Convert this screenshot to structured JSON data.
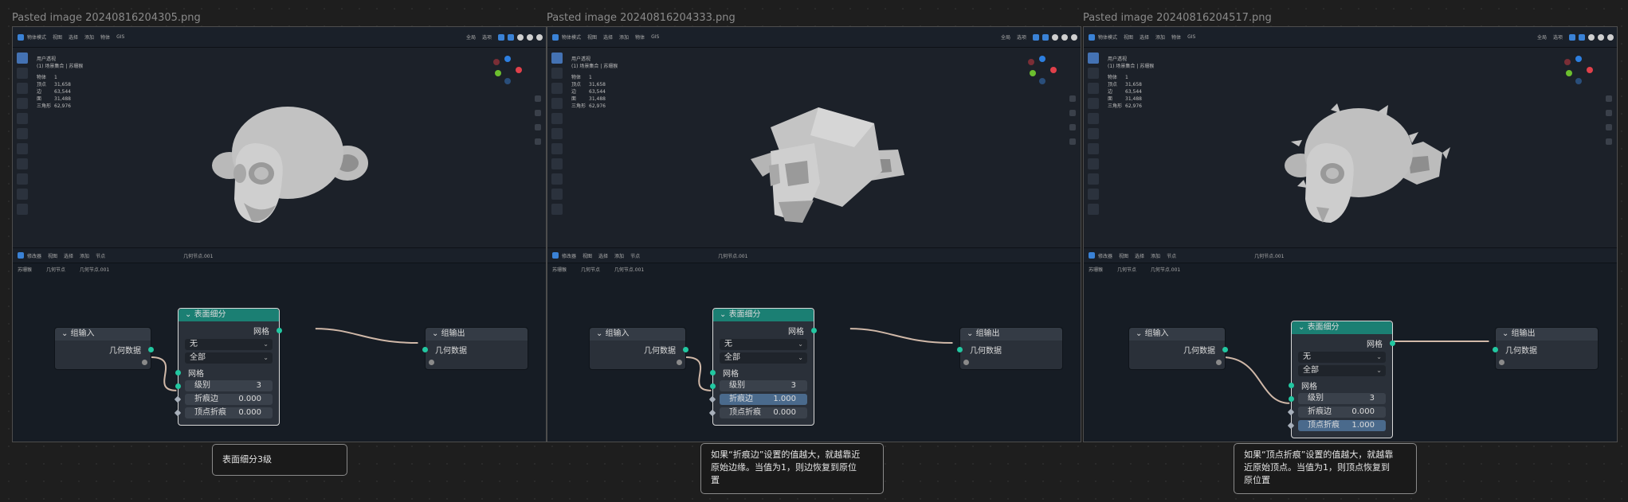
{
  "captions": [
    "Pasted image 20240816204305.png",
    "Pasted image 20240816204333.png",
    "Pasted image 20240816204517.png"
  ],
  "viewport": {
    "mode_label": "物体模式",
    "menu": [
      "视图",
      "选择",
      "添加",
      "物体",
      "GIS"
    ],
    "view_label": "全局",
    "shading_label": "选项",
    "view_title": "用户透视",
    "collection": "(1) 场景集合 | 苏珊猴",
    "stats": [
      {
        "k": "物体",
        "v": "1"
      },
      {
        "k": "顶点",
        "v": "31,658"
      },
      {
        "k": "边",
        "v": "63,544"
      },
      {
        "k": "面",
        "v": "31,488"
      },
      {
        "k": "三角形",
        "v": "62,976"
      }
    ]
  },
  "node_editor": {
    "mode_label": "修改器",
    "menu": [
      "视图",
      "选择",
      "添加",
      "节点"
    ],
    "tree_label": "几何节点.001",
    "crumbs": [
      "苏珊猴",
      "几何节点",
      "几何节点.001"
    ]
  },
  "nodes": {
    "group_input": {
      "title": "组输入",
      "socket": "几何数据"
    },
    "subdivide": {
      "title": "表面细分",
      "output": "网格",
      "uv_smooth": "无",
      "boundary": "全部",
      "input": "网格",
      "level_label": "级别",
      "edge_crease_label": "折痕边",
      "vertex_crease_label": "顶点折痕"
    },
    "group_output": {
      "title": "组输出",
      "socket": "几何数据"
    }
  },
  "panels": [
    {
      "level": "3",
      "edge_crease": "0.000",
      "vertex_crease": "0.000",
      "highlight": "none",
      "mesh": "smooth"
    },
    {
      "level": "3",
      "edge_crease": "1.000",
      "vertex_crease": "0.000",
      "highlight": "edge",
      "mesh": "faceted"
    },
    {
      "level": "3",
      "edge_crease": "0.000",
      "vertex_crease": "1.000",
      "highlight": "vertex",
      "mesh": "spiky"
    }
  ],
  "notes": [
    [
      "表面细分3级"
    ],
    [
      "如果“折痕边”设置的值越大，就越靠近",
      "原始边缘。当值为1，则边恢复到原位",
      "置"
    ],
    [
      "如果“顶点折痕”设置的值越大，就越靠",
      "近原始顶点。当值为1，则顶点恢复到",
      "原位置"
    ]
  ],
  "colors": {
    "socket_geometry": "#22c7a1",
    "subdivide_header": "#1b7f73",
    "field_highlight": "#4a6a8c"
  }
}
